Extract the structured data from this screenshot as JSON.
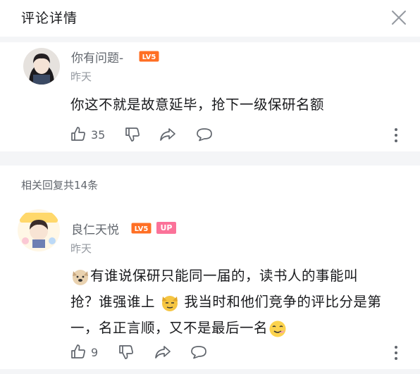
{
  "header": {
    "title": "评论详情",
    "close_icon": "close-icon"
  },
  "main_comment": {
    "username": "你有问题-",
    "level_badge": "LV5",
    "time": "昨天",
    "content": "你这不就是故意延毕，抢下一级保研名额",
    "like_count": "35",
    "icons": [
      "thumb-up-icon",
      "thumb-down-icon",
      "share-icon",
      "reply-icon",
      "more-icon"
    ]
  },
  "replies_header": "相关回复共14条",
  "reply": {
    "username": "良仁天悦",
    "level_badge": "LV5",
    "up_badge": "UP",
    "time": "昨天",
    "content_lines": [
      "有谁说保研只能同一届的，读书人的事能叫",
      "抢？谁强谁上",
      "我当时和他们竞争的评比分是第",
      "一，名正言顺，又不是最后一名"
    ],
    "like_count": "9",
    "icons": [
      "thumb-up-icon",
      "thumb-down-icon",
      "share-icon",
      "reply-icon",
      "more-icon"
    ]
  },
  "colors": {
    "lv5_orange": "#ff6f24",
    "up_pink": "#fb7299",
    "secondary_text": "#61666d",
    "muted_text": "#9499a0"
  }
}
